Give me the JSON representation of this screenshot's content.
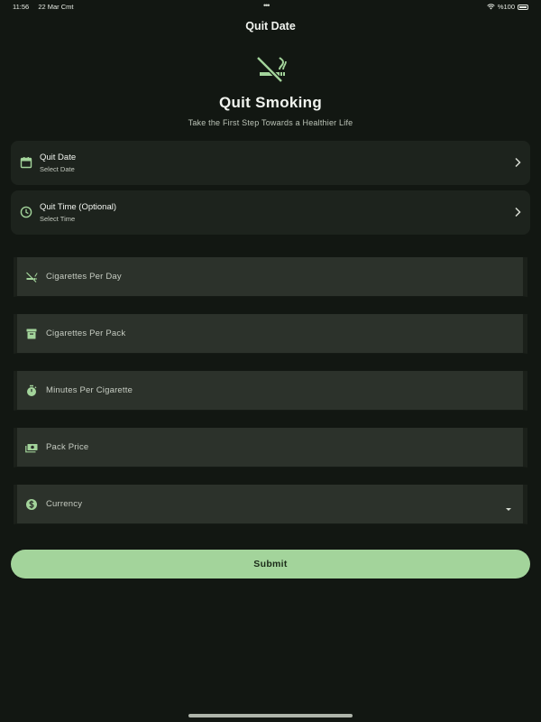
{
  "status_bar": {
    "time": "11:56",
    "date": "22 Mar Cmt",
    "multitask_dots": "•••",
    "battery": "%100"
  },
  "app_bar": {
    "title": "Quit Date"
  },
  "hero": {
    "icon": "no-smoking-icon",
    "title": "Quit Smoking",
    "subtitle": "Take the First Step Towards a Healthier Life"
  },
  "pickers": [
    {
      "icon": "calendar-icon",
      "title": "Quit Date",
      "value": "Select Date"
    },
    {
      "icon": "clock-icon",
      "title": "Quit Time (Optional)",
      "value": "Select Time"
    }
  ],
  "fields": [
    {
      "icon": "no-smoking-icon",
      "label": "Cigarettes Per Day"
    },
    {
      "icon": "box-icon",
      "label": "Cigarettes Per Pack"
    },
    {
      "icon": "stopwatch-icon",
      "label": "Minutes Per Cigarette"
    },
    {
      "icon": "money-icon",
      "label": "Pack Price"
    },
    {
      "icon": "dollar-icon",
      "label": "Currency",
      "type": "dropdown"
    }
  ],
  "submit": {
    "label": "Submit"
  },
  "colors": {
    "background": "#121712",
    "accent": "#a3d49b",
    "card": "#1d231d",
    "field": "#2c322b"
  }
}
